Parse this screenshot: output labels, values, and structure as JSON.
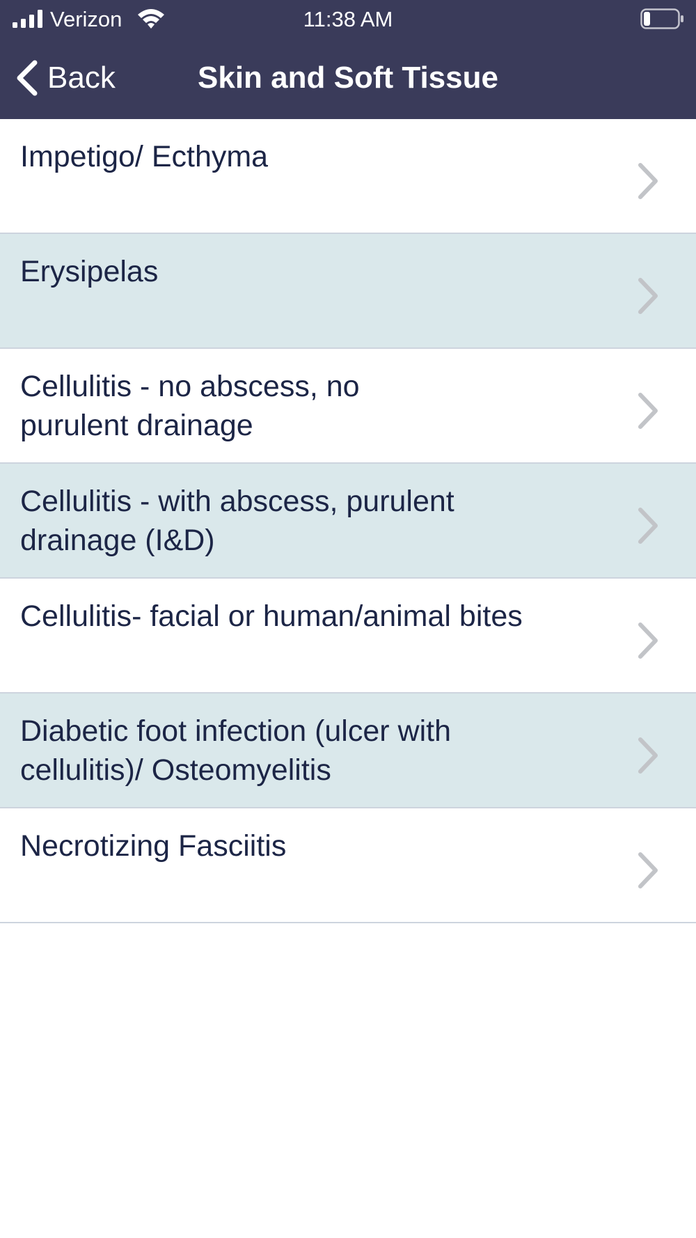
{
  "status_bar": {
    "carrier": "Verizon",
    "time": "11:38 AM",
    "signal_icon": "cellular-signal-icon",
    "wifi_icon": "wifi-icon",
    "battery_icon": "battery-icon",
    "battery_level": 0.2
  },
  "nav": {
    "back_label": "Back",
    "title": "Skin and Soft Tissue"
  },
  "colors": {
    "nav_background": "#3a3b5a",
    "row_alt_background": "#dae8eb",
    "text": "#1c2546",
    "chevron": "#c2c4c8"
  },
  "items": [
    {
      "label": "Impetigo/ Ecthyma"
    },
    {
      "label": "Erysipelas"
    },
    {
      "label": "Cellulitis - no abscess, no purulent drainage"
    },
    {
      "label": "Cellulitis - with abscess, purulent drainage (I&D)"
    },
    {
      "label": "Cellulitis- facial or human/animal bites"
    },
    {
      "label": "Diabetic foot infection (ulcer with cellulitis)/ Osteomyelitis"
    },
    {
      "label": "Necrotizing Fasciitis"
    }
  ]
}
